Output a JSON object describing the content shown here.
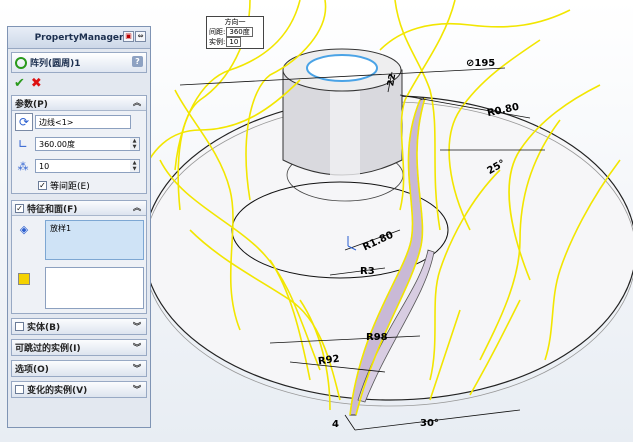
{
  "panel": {
    "title": "PropertyManager",
    "feature_name": "阵列(圆周)1",
    "help_glyph": "?",
    "ok_glyph": "✔",
    "cancel_glyph": "✖",
    "params": {
      "header": "参数(P)",
      "axis_value": "边线<1>",
      "angle_value": "360.00度",
      "count_value": "10",
      "equal_spacing_label": "等间距(E)",
      "equal_spacing_checked": true
    },
    "features": {
      "header": "特征和面(F)",
      "checked": true,
      "items": [
        "放样1"
      ]
    },
    "collapsed": [
      {
        "label": "实体(B)",
        "checkbox": true
      },
      {
        "label": "可跳过的实例(I)",
        "checkbox": false
      },
      {
        "label": "选项(O)",
        "checkbox": false
      },
      {
        "label": "变化的实例(V)",
        "checkbox": true
      }
    ]
  },
  "callout": {
    "title": "方向一",
    "spacing_label": "间距:",
    "spacing_value": "360度",
    "instances_label": "实例:",
    "instances_value": "10"
  },
  "dimensions": {
    "dia195": "195",
    "r080": "R0.80",
    "ang25": "25°",
    "r180": "R1.80",
    "r3": "R3",
    "r98": "R98",
    "r92": "R92",
    "ang30": "30°",
    "d4": "4",
    "d22": "22"
  },
  "colors": {
    "accent_yellow": "#f2e600",
    "panel_border": "#7f94b4",
    "selection_blue": "#cfe3f6"
  }
}
